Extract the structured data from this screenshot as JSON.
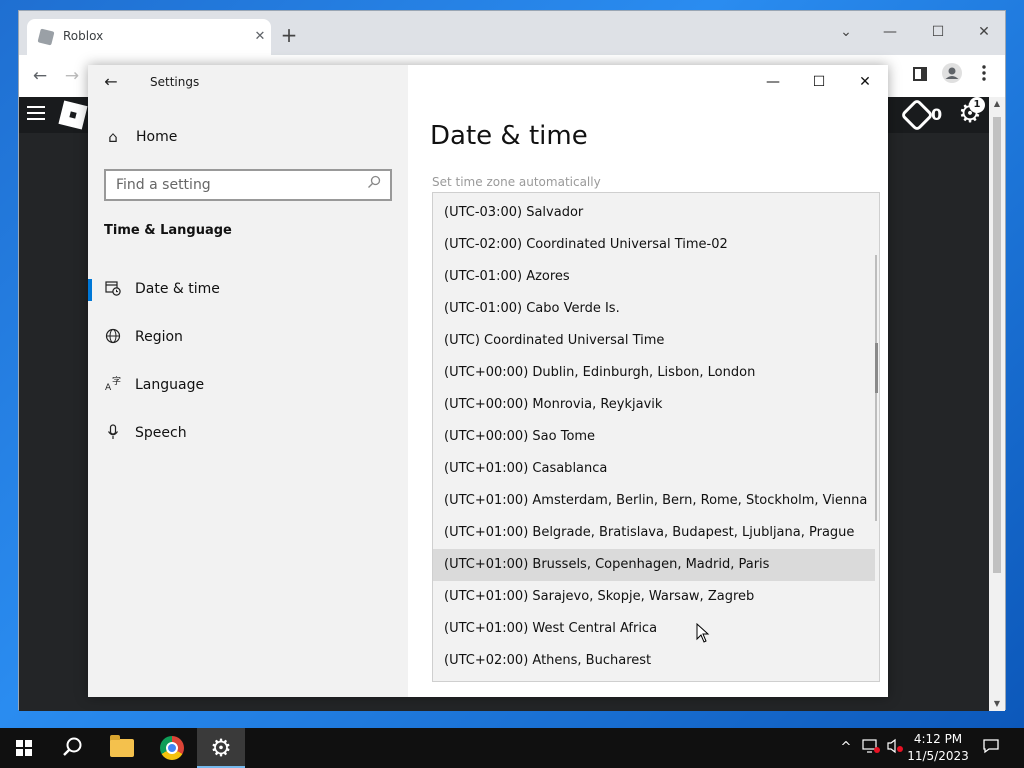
{
  "browser": {
    "tab_title": "Roblox",
    "tab_close": "✕",
    "new_tab": "+",
    "ctrl_dropdown": "⌄",
    "ctrl_minimize": "—",
    "ctrl_maximize": "☐",
    "ctrl_close": "✕",
    "nav_back": "←",
    "nav_forward": "→"
  },
  "roblox": {
    "robux_count": "0",
    "notification_count": "1"
  },
  "settings": {
    "window_title": "Settings",
    "back": "←",
    "minimize": "—",
    "maximize": "☐",
    "close": "✕",
    "home_label": "Home",
    "search_placeholder": "Find a setting",
    "section_title": "Time & Language",
    "nav_items": [
      {
        "label": "Date & time",
        "icon": "calendar-clock-icon"
      },
      {
        "label": "Region",
        "icon": "globe-icon"
      },
      {
        "label": "Language",
        "icon": "language-icon"
      },
      {
        "label": "Speech",
        "icon": "microphone-icon"
      }
    ],
    "page_title": "Date & time",
    "auto_timezone_label": "Set time zone automatically",
    "timezones": [
      "(UTC-03:00) Salvador",
      "(UTC-02:00) Coordinated Universal Time-02",
      "(UTC-01:00) Azores",
      "(UTC-01:00) Cabo Verde Is.",
      "(UTC) Coordinated Universal Time",
      "(UTC+00:00) Dublin, Edinburgh, Lisbon, London",
      "(UTC+00:00) Monrovia, Reykjavik",
      "(UTC+00:00) Sao Tome",
      "(UTC+01:00) Casablanca",
      "(UTC+01:00) Amsterdam, Berlin, Bern, Rome, Stockholm, Vienna",
      "(UTC+01:00) Belgrade, Bratislava, Budapest, Ljubljana, Prague",
      "(UTC+01:00) Brussels, Copenhagen, Madrid, Paris",
      "(UTC+01:00) Sarajevo, Skopje, Warsaw, Zagreb",
      "(UTC+01:00) West Central Africa",
      "(UTC+02:00) Athens, Bucharest"
    ],
    "hovered_index": 11
  },
  "taskbar": {
    "time": "4:12 PM",
    "date": "11/5/2023"
  },
  "colors": {
    "accent": "#0078d7",
    "taskbar": "#101010",
    "hover": "#dadada"
  }
}
